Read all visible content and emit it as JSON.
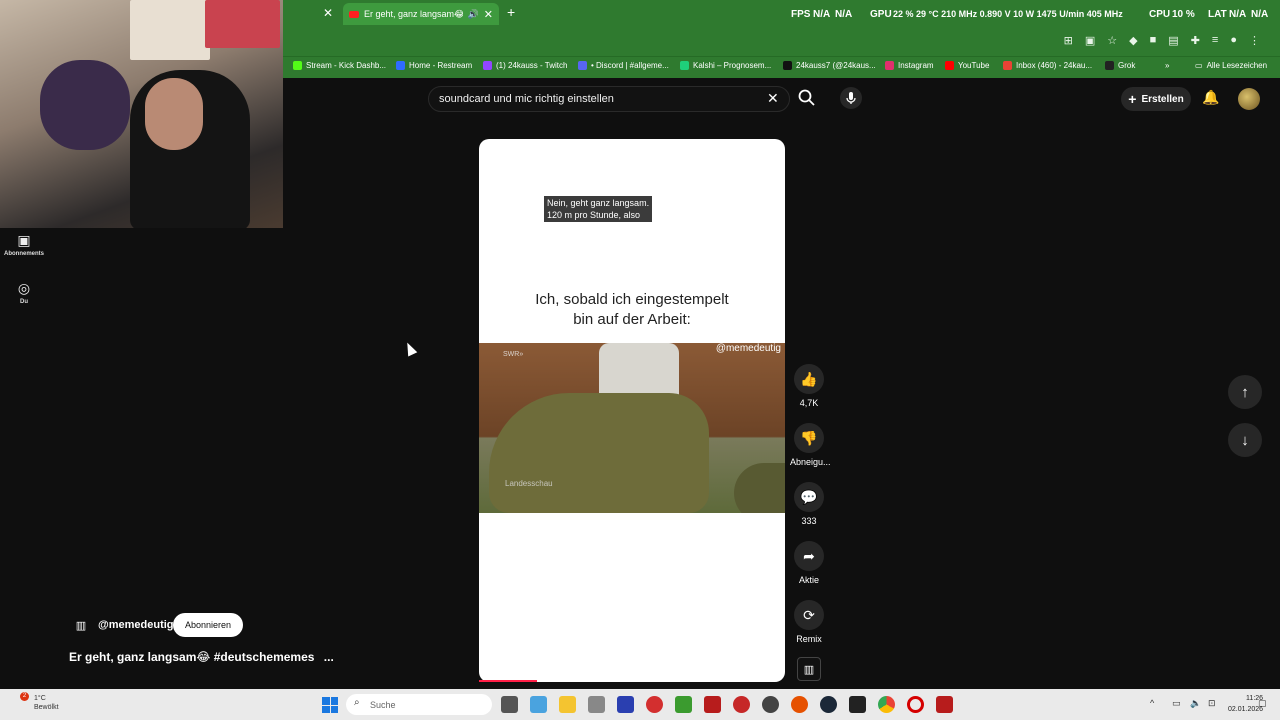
{
  "browser": {
    "active_tab_title": "Er geht, ganz langsam😂 #deutschememes",
    "performance": {
      "fps": "FPS",
      "fps_val1": "N/A",
      "fps_val2": "N/A",
      "gpu": "GPU",
      "gpu_stats": "22 % 29 °C 210 MHz 0.890 V 10 W 1475 U/min 405 MHz",
      "cpu": "CPU",
      "cpu_val": "10 %",
      "lat": "LAT",
      "lat_val1": "N/A",
      "lat_val2": "N/A"
    },
    "bookmarks": [
      {
        "label": "Stream - Kick Dashb...",
        "color": "#53fc18"
      },
      {
        "label": "Home - Restream",
        "color": "#2f6bff"
      },
      {
        "label": "(1) 24kauss - Twitch",
        "color": "#9146ff"
      },
      {
        "label": "• Discord | #allgeme...",
        "color": "#5865f2"
      },
      {
        "label": "Kalshi – Prognosem...",
        "color": "#1fcf7a"
      },
      {
        "label": "24kauss7 (@24kaus...",
        "color": "#111111"
      },
      {
        "label": "Instagram",
        "color": "#e1306c"
      },
      {
        "label": "YouTube",
        "color": "#ff0000"
      },
      {
        "label": "Inbox (460) - 24kau...",
        "color": "#ea4335"
      },
      {
        "label": "Grok",
        "color": "#222222"
      }
    ],
    "all_bookmarks": "Alle Lesezeichen"
  },
  "sidebar": {
    "items": [
      {
        "label": "Abonnements",
        "icon": "subscriptions-icon"
      },
      {
        "label": "Du",
        "icon": "user-icon"
      }
    ]
  },
  "header": {
    "search_value": "soundcard und mic richtig einstellen",
    "create_label": "Erstellen"
  },
  "short": {
    "caption_line1": "Nein, geht ganz langsam.",
    "caption_line2": "120 m pro Stunde, also",
    "meme_line1": "Ich, sobald ich eingestempelt",
    "meme_line2": "bin auf der Arbeit:",
    "video_handle": "@memedeutig",
    "video_wm": "Landesschau",
    "video_swr": "SWR»",
    "progress_percent": 19
  },
  "actions": {
    "like_count": "4,7K",
    "dislike_label": "Abneigu...",
    "comment_count": "333",
    "share_label": "Aktie",
    "remix_label": "Remix"
  },
  "channel": {
    "name": "@memedeutig",
    "subscribe_label": "Abonnieren",
    "short_title": "Er geht, ganz langsam😂 #deutschememes",
    "more": "..."
  },
  "taskbar": {
    "weather_temp": "1°C",
    "weather_desc": "Bewölkt",
    "weather_badge": "2",
    "search_placeholder": "Suche",
    "time": "11:26",
    "date": "02.01.2026"
  }
}
